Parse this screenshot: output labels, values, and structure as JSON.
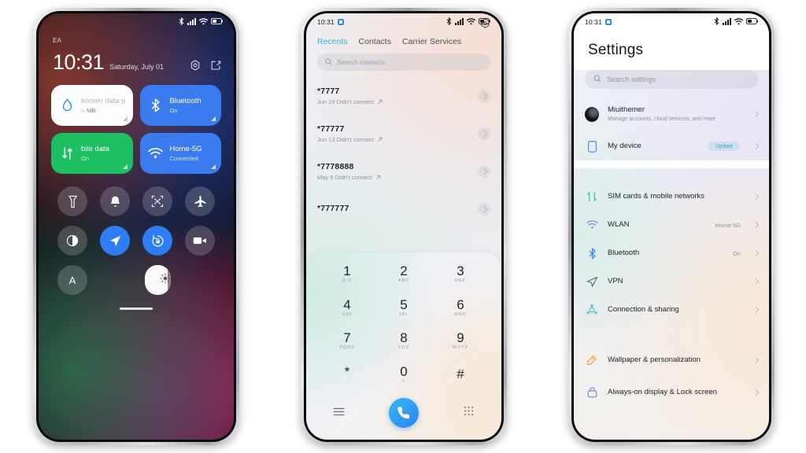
{
  "control_center": {
    "carrier": "EA",
    "time": "10:31",
    "date": "Saturday, July 01",
    "header_icons": [
      "settings-gear-icon",
      "edit-icon"
    ],
    "status_bar": {
      "bluetooth": "bluetooth-icon",
      "signal": "signal-icon",
      "wifi": "wifi-icon",
      "battery": "battery-icon"
    },
    "tiles": [
      {
        "title": "known data pl.",
        "subtitle": "-- MB",
        "icon": "data-usage-drop-icon",
        "state": "off",
        "color": "#fdfdfd"
      },
      {
        "title": "Bluetooth",
        "subtitle": "On",
        "icon": "bluetooth-icon",
        "state": "on",
        "color": "#3a7bf0"
      },
      {
        "title": "bile data",
        "subtitle": "On",
        "icon": "mobile-data-icon",
        "state": "on",
        "color": "#1cbf62"
      },
      {
        "title": "Home-5G",
        "subtitle": "Connected",
        "icon": "wifi-icon",
        "state": "on",
        "color": "#3a7bf0"
      }
    ],
    "toggles": [
      {
        "name": "flashlight",
        "on": false
      },
      {
        "name": "ringer-bell",
        "on": false
      },
      {
        "name": "screenshot",
        "on": false
      },
      {
        "name": "airplane-mode",
        "on": false
      },
      {
        "name": "dark-mode",
        "on": false
      },
      {
        "name": "location",
        "on": true
      },
      {
        "name": "rotation-lock",
        "on": true
      },
      {
        "name": "screen-recorder",
        "on": false
      },
      {
        "name": "auto-brightness",
        "on": false
      }
    ],
    "auto_brightness_label": "A",
    "brightness_percent": 88
  },
  "dialer": {
    "status_time": "10:31",
    "tabs": [
      {
        "label": "Recents",
        "active": true
      },
      {
        "label": "Contacts",
        "active": false
      },
      {
        "label": "Carrier Services",
        "active": false
      }
    ],
    "search_placeholder": "Search contacts",
    "calls": [
      {
        "number": "*7777",
        "detail": "Jun 19 Didn't connect"
      },
      {
        "number": "*77777",
        "detail": "Jun 13 Didn't connect"
      },
      {
        "number": "*7778888",
        "detail": "May 9 Didn't connect"
      },
      {
        "number": "*777777",
        "detail": ""
      }
    ],
    "keys": [
      {
        "digit": "1",
        "sub": "Q.O"
      },
      {
        "digit": "2",
        "sub": "ABC"
      },
      {
        "digit": "3",
        "sub": "DEF"
      },
      {
        "digit": "4",
        "sub": "GHI"
      },
      {
        "digit": "5",
        "sub": "JKL"
      },
      {
        "digit": "6",
        "sub": "MNO"
      },
      {
        "digit": "7",
        "sub": "PQRS"
      },
      {
        "digit": "8",
        "sub": "TUV"
      },
      {
        "digit": "9",
        "sub": "WXYZ"
      },
      {
        "digit": "*",
        "sub": ","
      },
      {
        "digit": "0",
        "sub": "+"
      },
      {
        "digit": "#",
        "sub": ""
      }
    ],
    "bottom_bar": [
      "menu-icon",
      "call-button",
      "keypad-icon"
    ]
  },
  "settings": {
    "status_time": "10:31",
    "title": "Settings",
    "search_placeholder": "Search settings",
    "account": {
      "name": "Miuithemer",
      "subtitle": "Manage accounts, cloud services, and more",
      "icon": "avatar"
    },
    "device": {
      "label": "My device",
      "badge": "Update",
      "icon": "device-icon"
    },
    "network_group": [
      {
        "label": "SIM cards & mobile networks",
        "value": "",
        "icon": "sim-card-icon"
      },
      {
        "label": "WLAN",
        "value": "Home-5G",
        "icon": "wifi-icon"
      },
      {
        "label": "Bluetooth",
        "value": "On",
        "icon": "bluetooth-icon"
      },
      {
        "label": "VPN",
        "value": "",
        "icon": "vpn-icon"
      },
      {
        "label": "Connection & sharing",
        "value": "",
        "icon": "connection-sharing-icon"
      }
    ],
    "display_group": [
      {
        "label": "Wallpaper & personalization",
        "value": "",
        "icon": "wallpaper-icon"
      },
      {
        "label": "Always-on display & Lock screen",
        "value": "",
        "icon": "lock-screen-icon"
      }
    ]
  }
}
